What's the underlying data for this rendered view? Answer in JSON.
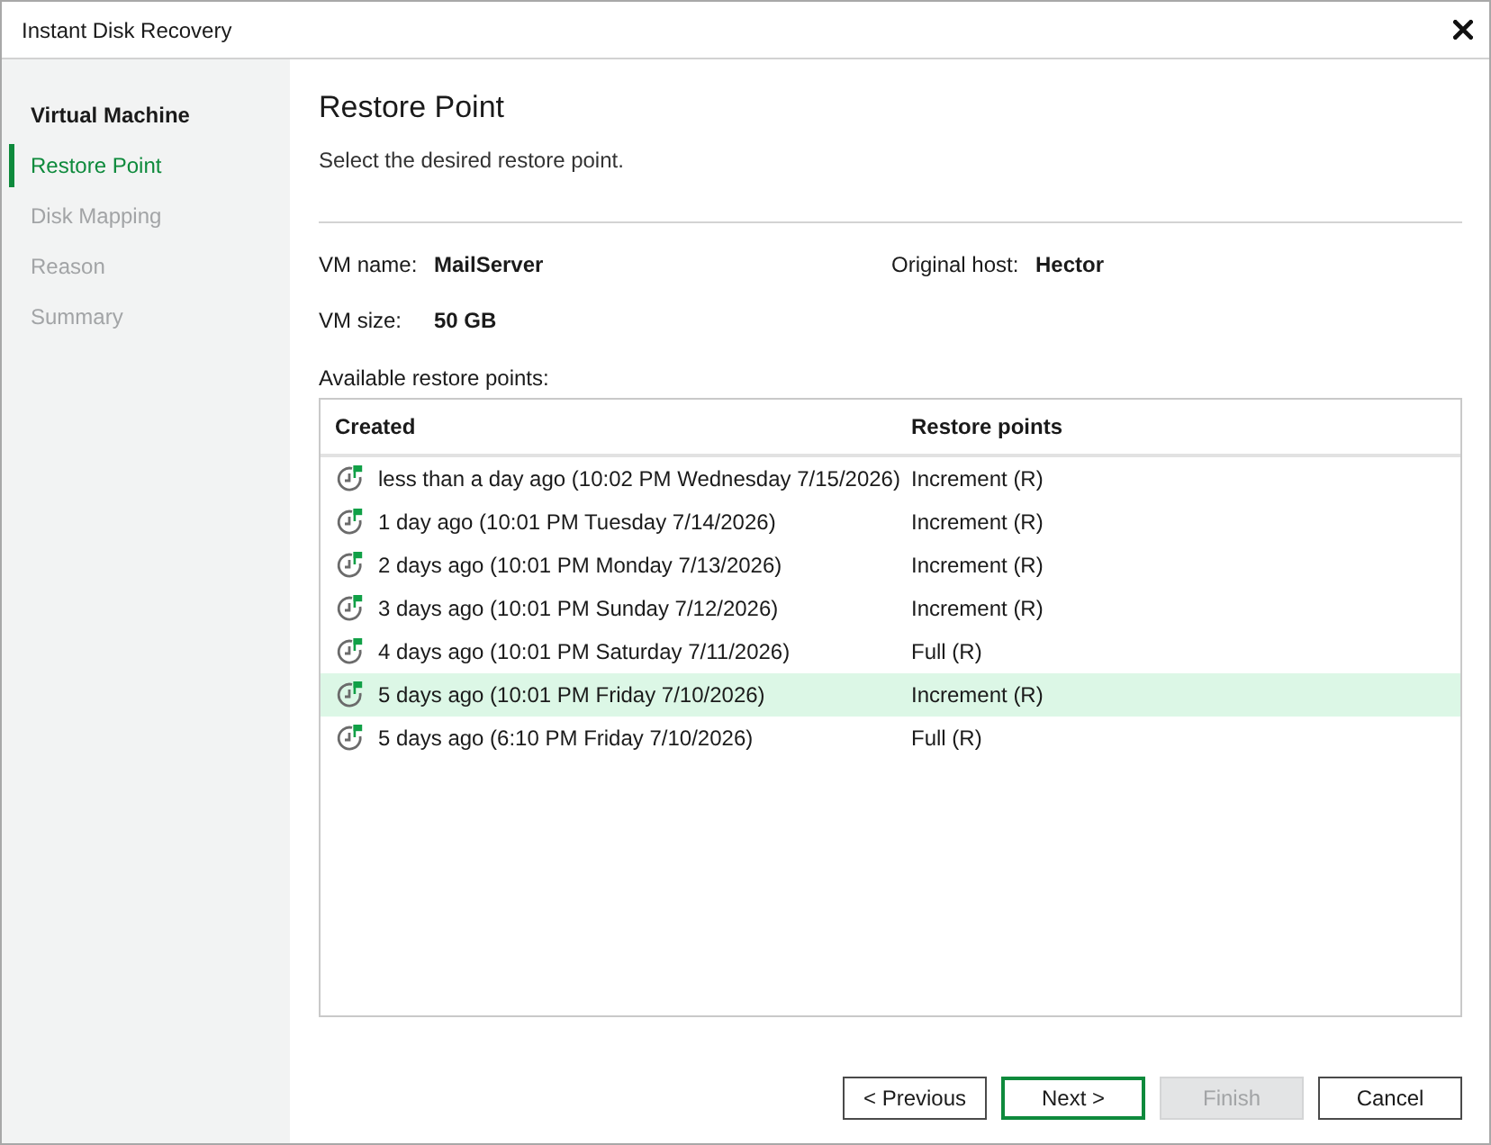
{
  "window": {
    "title": "Instant Disk Recovery"
  },
  "sidebar": {
    "steps": [
      {
        "label": "Virtual Machine",
        "selected": false,
        "disabled": false
      },
      {
        "label": "Restore Point",
        "selected": true,
        "disabled": false
      },
      {
        "label": "Disk Mapping",
        "selected": false,
        "disabled": true
      },
      {
        "label": "Reason",
        "selected": false,
        "disabled": true
      },
      {
        "label": "Summary",
        "selected": false,
        "disabled": true
      }
    ]
  },
  "page": {
    "title": "Restore Point",
    "description": "Select the desired restore point."
  },
  "details": [
    {
      "label": "VM name:",
      "value": "MailServer"
    },
    {
      "label": "Original host:",
      "value": "Hector"
    },
    {
      "label": "VM size:",
      "value": "50 GB"
    }
  ],
  "table": {
    "caption": "Available restore points:",
    "columns": [
      "Created",
      "Restore points"
    ],
    "rows": [
      {
        "created": "less than a day ago (10:02 PM Wednesday 7/15/2026)",
        "restore_point": "Increment (R)",
        "selected": false
      },
      {
        "created": "1 day ago (10:01 PM Tuesday 7/14/2026)",
        "restore_point": "Increment (R)",
        "selected": false
      },
      {
        "created": "2 days ago (10:01 PM Monday 7/13/2026)",
        "restore_point": "Increment (R)",
        "selected": false
      },
      {
        "created": "3 days ago (10:01 PM Sunday 7/12/2026)",
        "restore_point": "Increment (R)",
        "selected": false
      },
      {
        "created": "4 days ago (10:01 PM Saturday 7/11/2026)",
        "restore_point": "Full (R)",
        "selected": false
      },
      {
        "created": "5 days ago (10:01 PM Friday 7/10/2026)",
        "restore_point": "Increment (R)",
        "selected": true
      },
      {
        "created": "5 days ago (6:10 PM Friday 7/10/2026)",
        "restore_point": "Full (R)",
        "selected": false
      }
    ]
  },
  "buttons": [
    {
      "label": "< Previous",
      "kind": "normal",
      "disabled": false
    },
    {
      "label": "Next >",
      "kind": "default",
      "disabled": false
    },
    {
      "label": "Finish",
      "kind": "normal",
      "disabled": true
    },
    {
      "label": "Cancel",
      "kind": "normal",
      "disabled": false
    }
  ]
}
